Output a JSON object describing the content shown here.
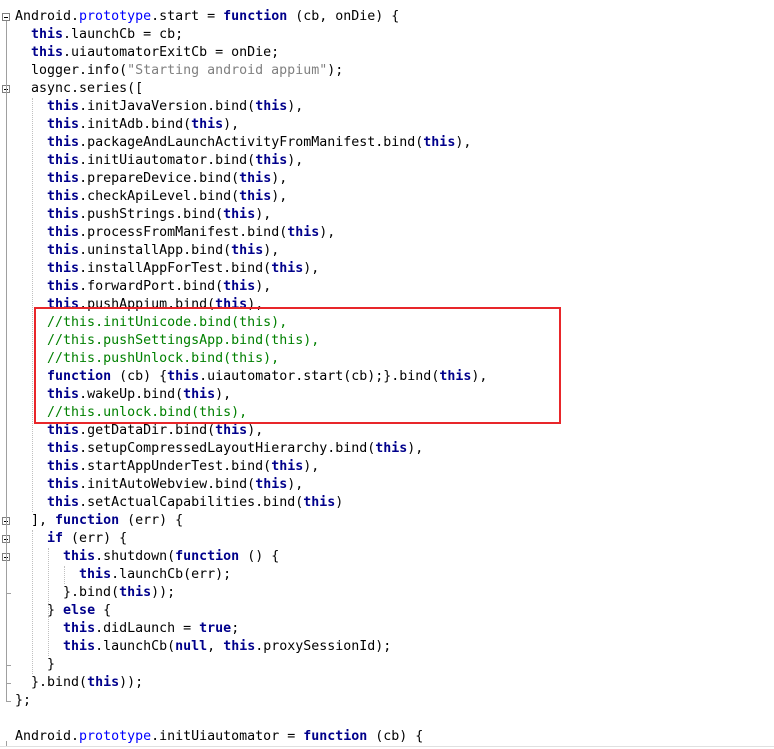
{
  "editor": {
    "lines": [
      [
        [
          "Android.",
          "plain"
        ],
        [
          "prototype",
          "kw2"
        ],
        [
          ".start = ",
          "plain"
        ],
        [
          "function",
          "kw"
        ],
        [
          " (cb, onDie) {",
          "plain"
        ]
      ],
      [
        [
          "  ",
          "plain"
        ],
        [
          "this",
          "kw"
        ],
        [
          ".launchCb = cb;",
          "plain"
        ]
      ],
      [
        [
          "  ",
          "plain"
        ],
        [
          "this",
          "kw"
        ],
        [
          ".uiautomatorExitCb = onDie;",
          "plain"
        ]
      ],
      [
        [
          "  logger.info(",
          "plain"
        ],
        [
          "\"Starting android appium\"",
          "str"
        ],
        [
          ");",
          "plain"
        ]
      ],
      [
        [
          "  async.series([",
          "plain"
        ]
      ],
      [
        [
          "    ",
          "plain"
        ],
        [
          "this",
          "kw"
        ],
        [
          ".initJavaVersion.bind(",
          "plain"
        ],
        [
          "this",
          "kw"
        ],
        [
          "),",
          "plain"
        ]
      ],
      [
        [
          "    ",
          "plain"
        ],
        [
          "this",
          "kw"
        ],
        [
          ".initAdb.bind(",
          "plain"
        ],
        [
          "this",
          "kw"
        ],
        [
          "),",
          "plain"
        ]
      ],
      [
        [
          "    ",
          "plain"
        ],
        [
          "this",
          "kw"
        ],
        [
          ".packageAndLaunchActivityFromManifest.bind(",
          "plain"
        ],
        [
          "this",
          "kw"
        ],
        [
          "),",
          "plain"
        ]
      ],
      [
        [
          "    ",
          "plain"
        ],
        [
          "this",
          "kw"
        ],
        [
          ".initUiautomator.bind(",
          "plain"
        ],
        [
          "this",
          "kw"
        ],
        [
          "),",
          "plain"
        ]
      ],
      [
        [
          "    ",
          "plain"
        ],
        [
          "this",
          "kw"
        ],
        [
          ".prepareDevice.bind(",
          "plain"
        ],
        [
          "this",
          "kw"
        ],
        [
          "),",
          "plain"
        ]
      ],
      [
        [
          "    ",
          "plain"
        ],
        [
          "this",
          "kw"
        ],
        [
          ".checkApiLevel.bind(",
          "plain"
        ],
        [
          "this",
          "kw"
        ],
        [
          "),",
          "plain"
        ]
      ],
      [
        [
          "    ",
          "plain"
        ],
        [
          "this",
          "kw"
        ],
        [
          ".pushStrings.bind(",
          "plain"
        ],
        [
          "this",
          "kw"
        ],
        [
          "),",
          "plain"
        ]
      ],
      [
        [
          "    ",
          "plain"
        ],
        [
          "this",
          "kw"
        ],
        [
          ".processFromManifest.bind(",
          "plain"
        ],
        [
          "this",
          "kw"
        ],
        [
          "),",
          "plain"
        ]
      ],
      [
        [
          "    ",
          "plain"
        ],
        [
          "this",
          "kw"
        ],
        [
          ".uninstallApp.bind(",
          "plain"
        ],
        [
          "this",
          "kw"
        ],
        [
          "),",
          "plain"
        ]
      ],
      [
        [
          "    ",
          "plain"
        ],
        [
          "this",
          "kw"
        ],
        [
          ".installAppForTest.bind(",
          "plain"
        ],
        [
          "this",
          "kw"
        ],
        [
          "),",
          "plain"
        ]
      ],
      [
        [
          "    ",
          "plain"
        ],
        [
          "this",
          "kw"
        ],
        [
          ".forwardPort.bind(",
          "plain"
        ],
        [
          "this",
          "kw"
        ],
        [
          "),",
          "plain"
        ]
      ],
      [
        [
          "    ",
          "plain"
        ],
        [
          "this",
          "kw"
        ],
        [
          ".pushAppium.bind(",
          "plain"
        ],
        [
          "this",
          "kw"
        ],
        [
          "),",
          "plain"
        ]
      ],
      [
        [
          "    ",
          "plain"
        ],
        [
          "//this.initUnicode.bind(this),",
          "cm"
        ]
      ],
      [
        [
          "    ",
          "plain"
        ],
        [
          "//this.pushSettingsApp.bind(this),",
          "cm"
        ]
      ],
      [
        [
          "    ",
          "plain"
        ],
        [
          "//this.pushUnlock.bind(this),",
          "cm"
        ]
      ],
      [
        [
          "    ",
          "plain"
        ],
        [
          "function",
          "kw"
        ],
        [
          " (cb) {",
          "plain"
        ],
        [
          "this",
          "kw"
        ],
        [
          ".uiautomator.start(cb);}.bind(",
          "plain"
        ],
        [
          "this",
          "kw"
        ],
        [
          "),",
          "plain"
        ]
      ],
      [
        [
          "    ",
          "plain"
        ],
        [
          "this",
          "kw"
        ],
        [
          ".wakeUp.bind(",
          "plain"
        ],
        [
          "this",
          "kw"
        ],
        [
          "),",
          "plain"
        ]
      ],
      [
        [
          "    ",
          "plain"
        ],
        [
          "//this.unlock.bind(this),",
          "cm"
        ]
      ],
      [
        [
          "    ",
          "plain"
        ],
        [
          "this",
          "kw"
        ],
        [
          ".getDataDir.bind(",
          "plain"
        ],
        [
          "this",
          "kw"
        ],
        [
          "),",
          "plain"
        ]
      ],
      [
        [
          "    ",
          "plain"
        ],
        [
          "this",
          "kw"
        ],
        [
          ".setupCompressedLayoutHierarchy.bind(",
          "plain"
        ],
        [
          "this",
          "kw"
        ],
        [
          "),",
          "plain"
        ]
      ],
      [
        [
          "    ",
          "plain"
        ],
        [
          "this",
          "kw"
        ],
        [
          ".startAppUnderTest.bind(",
          "plain"
        ],
        [
          "this",
          "kw"
        ],
        [
          "),",
          "plain"
        ]
      ],
      [
        [
          "    ",
          "plain"
        ],
        [
          "this",
          "kw"
        ],
        [
          ".initAutoWebview.bind(",
          "plain"
        ],
        [
          "this",
          "kw"
        ],
        [
          "),",
          "plain"
        ]
      ],
      [
        [
          "    ",
          "plain"
        ],
        [
          "this",
          "kw"
        ],
        [
          ".setActualCapabilities.bind(",
          "plain"
        ],
        [
          "this",
          "kw"
        ],
        [
          ")",
          "plain"
        ]
      ],
      [
        [
          "  ], ",
          "plain"
        ],
        [
          "function",
          "kw"
        ],
        [
          " (err) {",
          "plain"
        ]
      ],
      [
        [
          "    ",
          "plain"
        ],
        [
          "if",
          "kw"
        ],
        [
          " (err) {",
          "plain"
        ]
      ],
      [
        [
          "      ",
          "plain"
        ],
        [
          "this",
          "kw"
        ],
        [
          ".shutdown(",
          "plain"
        ],
        [
          "function",
          "kw"
        ],
        [
          " () {",
          "plain"
        ]
      ],
      [
        [
          "        ",
          "plain"
        ],
        [
          "this",
          "kw"
        ],
        [
          ".launchCb(err);",
          "plain"
        ]
      ],
      [
        [
          "      }.bind(",
          "plain"
        ],
        [
          "this",
          "kw"
        ],
        [
          "));",
          "plain"
        ]
      ],
      [
        [
          "    } ",
          "plain"
        ],
        [
          "else",
          "kw"
        ],
        [
          " {",
          "plain"
        ]
      ],
      [
        [
          "      ",
          "plain"
        ],
        [
          "this",
          "kw"
        ],
        [
          ".didLaunch = ",
          "plain"
        ],
        [
          "true",
          "kw"
        ],
        [
          ";",
          "plain"
        ]
      ],
      [
        [
          "      ",
          "plain"
        ],
        [
          "this",
          "kw"
        ],
        [
          ".launchCb(",
          "plain"
        ],
        [
          "null",
          "kw"
        ],
        [
          ", ",
          "plain"
        ],
        [
          "this",
          "kw"
        ],
        [
          ".proxySessionId);",
          "plain"
        ]
      ],
      [
        [
          "    }",
          "plain"
        ]
      ],
      [
        [
          "  }.bind(",
          "plain"
        ],
        [
          "this",
          "kw"
        ],
        [
          "));",
          "plain"
        ]
      ],
      [
        [
          "};",
          "plain"
        ]
      ],
      [
        [
          "",
          "plain"
        ]
      ],
      [
        [
          "Android.",
          "plain"
        ],
        [
          "prototype",
          "kw2"
        ],
        [
          ".initUiautomator = ",
          "plain"
        ],
        [
          "function",
          "kw"
        ],
        [
          " (cb) {",
          "plain"
        ]
      ]
    ],
    "fold_markers": [
      0,
      4,
      28,
      29,
      30
    ]
  },
  "highlight": {
    "color": "#e8262a"
  }
}
